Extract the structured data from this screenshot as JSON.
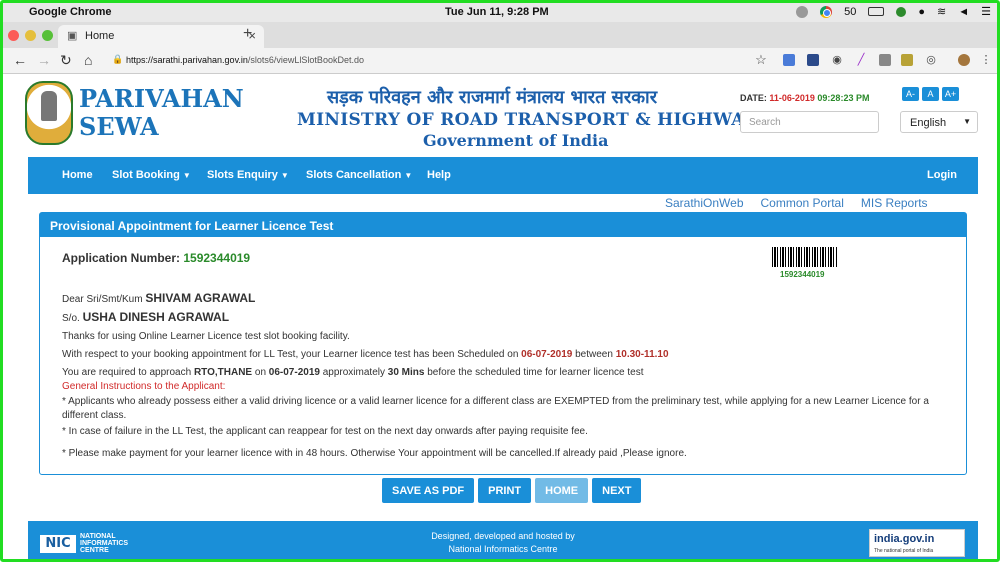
{
  "os": {
    "app_name": "Google Chrome",
    "clock": "Tue Jun 11,  9:28 PM",
    "battery": "50"
  },
  "browser": {
    "tab_title": "Home",
    "url_host": "https://sarathi.parivahan.gov.in",
    "url_path": "/slots6/viewLlSlotBookDet.do"
  },
  "header": {
    "brand_line1": "PARIVAHAN",
    "brand_line2": "SEWA",
    "hindi_title": "सड़क परिवहन और राजमार्ग मंत्रालय भारत सरकार",
    "ministry": "MINISTRY OF ROAD TRANSPORT & HIGHWAYS",
    "govt": "Government of India",
    "date_label": "DATE:",
    "date_value": "11-06-2019",
    "time_value": "09:28:23 PM",
    "font_buttons": [
      "A-",
      "A",
      "A+"
    ],
    "search_placeholder": "Search",
    "language": "English"
  },
  "nav": {
    "home": "Home",
    "slot_booking": "Slot Booking",
    "slots_enquiry": "Slots Enquiry",
    "slots_cancellation": "Slots Cancellation",
    "help": "Help",
    "login": "Login"
  },
  "sublinks": [
    "SarathiOnWeb",
    "Common Portal",
    "MIS Reports"
  ],
  "panel": {
    "title": "Provisional Appointment for Learner Licence Test",
    "app_no_label": "Application Number:",
    "app_no": "1592344019",
    "salutation": "Dear Sri/Smt/Kum",
    "name": "SHIVAM AGRAWAL",
    "so_label": "S/o.",
    "parent": "USHA DINESH AGRAWAL",
    "thanks": "Thanks for using Online Learner Licence test slot booking facility.",
    "scheduled_pre": "With respect to your booking appointment for LL Test, your Learner licence test has been Scheduled on",
    "scheduled_date": "06-07-2019",
    "between": "between",
    "slot": "10.30-11.10",
    "approach_pre": "You are required to approach",
    "rto": "RTO,THANE",
    "on": "on",
    "approach_date": "06-07-2019",
    "approx": "approximately",
    "mins": "30 Mins",
    "approach_post": "before the scheduled time for learner licence test",
    "instructions_heading": "General Instructions to the Applicant:",
    "instruction1": "* Applicants who already possess either a valid driving licence or a valid learner licence for a different class are EXEMPTED from the preliminary test, while applying for a new Learner Licence for a different class.",
    "instruction2": "* In case of failure in the LL Test, the applicant can reappear for test on the next day onwards after paying requisite fee.",
    "payment_note": "* Please make payment for your learner licence with in 48 hours. Otherwise Your appointment will be cancelled.If already paid ,Please ignore."
  },
  "actions": {
    "save_pdf": "SAVE AS PDF",
    "print": "PRINT",
    "home": "HOME",
    "next": "NEXT"
  },
  "footer": {
    "nic_logo": "NIC",
    "nic_line1": "NATIONAL",
    "nic_line2": "INFORMATICS",
    "nic_line3": "CENTRE",
    "designed_line1": "Designed, developed and hosted by",
    "designed_line2": "National Informatics Centre",
    "indiagov": "india.gov.in",
    "indiagov_sub": "The national portal of India"
  },
  "colors": {
    "primary": "#1a8fd8",
    "brand": "#1c74b9",
    "success": "#2a8a2a",
    "alert": "#d12a2a"
  }
}
